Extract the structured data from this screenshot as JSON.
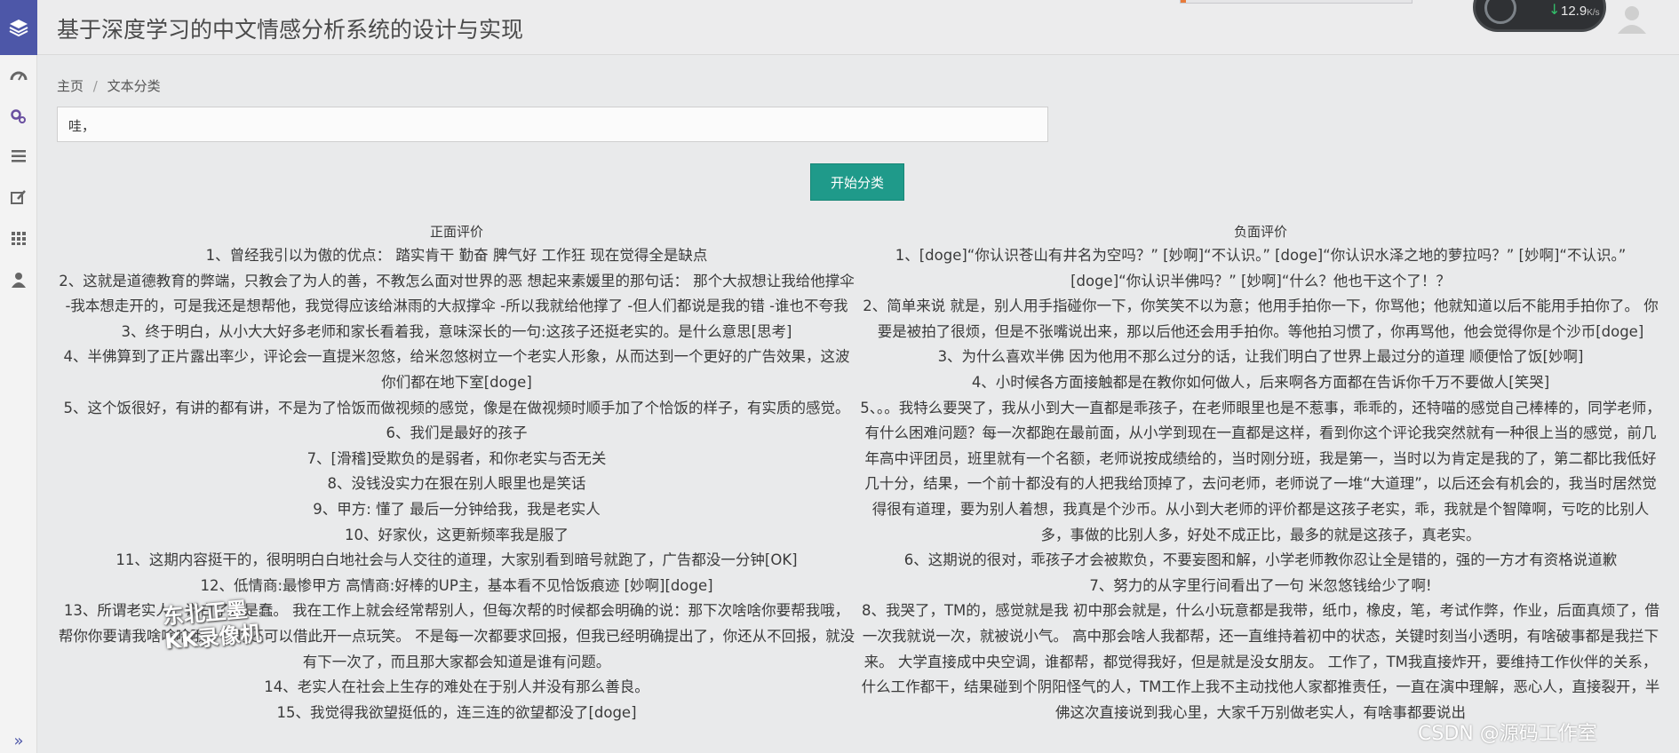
{
  "header": {
    "title": "基于深度学习的中文情感分析系统的设计与实现"
  },
  "net_monitor": {
    "speed": "12.9",
    "unit": "K/s"
  },
  "sidebar": {
    "items": [
      {
        "icon": "dashboard-icon"
      },
      {
        "icon": "gears-icon"
      },
      {
        "icon": "list-icon"
      },
      {
        "icon": "edit-icon"
      },
      {
        "icon": "grid-icon"
      },
      {
        "icon": "user-icon"
      }
    ],
    "expand_label": "»"
  },
  "breadcrumb": {
    "home": "主页",
    "separator": "/",
    "current": "文本分类"
  },
  "input": {
    "value": "哇，"
  },
  "classify_button": {
    "label": "开始分类"
  },
  "positive": {
    "header": "正面评价",
    "items": [
      "1、曾经我引以为傲的优点： 踏实肯干 勤奋 脾气好 工作狂 现在觉得全是缺点",
      "2、这就是道德教育的弊端，只教会了为人的善，不教怎么面对世界的恶 想起来素媛里的那句话： 那个大叔想让我给他撑伞 -我本想走开的，可是我还是想帮他，我觉得应该给淋雨的大叔撑伞 -所以我就给他撑了 -但人们都说是我的错 -谁也不夸我",
      "3、终于明白，从小大大好多老师和家长看着我，意味深长的一句:这孩子还挺老实的。是什么意思[思考]",
      "4、半佛算到了正片露出率少，评论会一直提米忽悠，给米忽悠树立一个老实人形象，从而达到一个更好的广告效果，这波你们都在地下室[doge]",
      "5、这个饭很好，有讲的都有讲，不是为了恰饭而做视频的感觉，像是在做视频时顺手加了个恰饭的样子，有实质的感觉。",
      "6、我们是最好的孩子",
      "7、[滑稽]受欺负的是弱者，和你老实与否无关",
      "8、没钱没实力在狠在别人眼里也是笑话",
      "9、甲方: 懂了 最后一分钟给我，我是老实人",
      "10、好家伙，这更新频率我是服了",
      "11、这期内容挺干的，很明明白白地社会与人交往的道理，大家别看到暗号就跑了，广告都没一分钟[OK]",
      "12、低情商:最惨甲方 高情商:好棒的UP主，基本看不见恰饭痕迹 [妙啊][doge]",
      "13、所谓老实人，说白了，是蠢。 我在工作上就会经常帮别人，但每次帮的时候都会明确的说：那下次啥啥你要帮我哦，帮你你要请我啥啥啥哦，有时还可以借此开一点玩笑。 不是每一次都要求回报，但我已经明确提出了，你还从不回报，就没有下一次了，而且那大家都会知道是谁有问题。",
      "14、老实人在社会上生存的难处在于别人并没有那么善良。",
      "15、我觉得我欲望挺低的，连三连的欲望都没了[doge]"
    ]
  },
  "negative": {
    "header": "负面评价",
    "items": [
      "1、[doge]“你认识苍山有井名为空吗？” [妙啊]“不认识。” [doge]“你认识水泽之地的萝拉吗？” [妙啊]“不认识。” [doge]“你认识半佛吗？” [妙啊]“什么？他也干这个了！？",
      "2、简单来说 就是，别人用手指碰你一下，你笑笑不以为意；他用手拍你一下，你骂他；他就知道以后不能用手拍你了。 你要是被拍了很烦，但是不张嘴说出来，那以后他还会用手拍你。等他拍习惯了，你再骂他，他会觉得你是个沙币[doge]",
      "3、为什么喜欢半佛 因为他用不那么过分的话，让我们明白了世界上最过分的道理 顺便恰了饭[妙啊]",
      "4、小时候各方面接触都是在教你如何做人，后来啊各方面都在告诉你千万不要做人[笑哭]",
      "5、。。我特么要哭了，我从小到大一直都是乖孩子，在老师眼里也是不惹事，乖乖的，还特喵的感觉自己棒棒的，同学老师，有什么困难问题？每一次都跑在最前面，从小学到现在一直都是这样，看到你这个评论我突然就有一种很上当的感觉，前几年高中评团员，班里就有一个名额，老师说按成绩给的，当时刚分班，我是第一，当时以为肯定是我的了，第二都比我低好几十分，结果，一个前十都没有的人把我给顶掉了，去问老师，老师说了一堆“大道理”，以后还会有机会的，我当时居然觉得很有道理，要为别人着想，我真是个沙币。从小到大老师的评价都是这孩子老实，乖，我就是个智障啊，亏吃的比别人多，事做的比别人多，好处不成正比，最多的就是这孩子，真老实。",
      "6、这期说的很对，乖孩子才会被欺负，不要妄图和解，小学老师教你忍让全是错的，强的一方才有资格说道歉",
      "7、努力的从字里行间看出了一句 米忽悠钱给少了啊!",
      "8、我哭了，TM的，感觉就是我 初中那会就是，什么小玩意都是我带，纸巾，橡皮，笔，考试作弊，作业，后面真烦了，借一次我就说一次，就被说小气。 高中那会啥人我都帮，还一直维持着初中的状态，关键时刻当小透明，有啥破事都是我拦下来。 大学直接成中央空调，谁都帮，都觉得我好，但是就是没女朋友。 工作了，TM我直接炸开，要维持工作伙伴的关系，什么工作都干，结果碰到个阴阳怪气的人，TM工作上我不主动找他人家都推责任，一直在演中理解，恶心人，直接裂开，半佛这次直接说到我心里，大家千万别做老实人，有啥事都要说出"
    ]
  },
  "watermark": {
    "line1": "东北正墨",
    "line2": "KK录像机",
    "corner": "CSDN @源码工作室"
  }
}
